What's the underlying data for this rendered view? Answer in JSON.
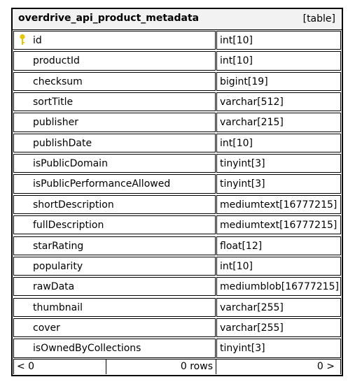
{
  "table": {
    "name": "overdrive_api_product_metadata",
    "kind": "[table]",
    "columns": [
      {
        "name": "id",
        "type": "int[10]",
        "key": true
      },
      {
        "name": "productId",
        "type": "int[10]"
      },
      {
        "name": "checksum",
        "type": "bigint[19]"
      },
      {
        "name": "sortTitle",
        "type": "varchar[512]"
      },
      {
        "name": "publisher",
        "type": "varchar[215]"
      },
      {
        "name": "publishDate",
        "type": "int[10]"
      },
      {
        "name": "isPublicDomain",
        "type": "tinyint[3]"
      },
      {
        "name": "isPublicPerformanceAllowed",
        "type": "tinyint[3]"
      },
      {
        "name": "shortDescription",
        "type": "mediumtext[16777215]"
      },
      {
        "name": "fullDescription",
        "type": "mediumtext[16777215]"
      },
      {
        "name": "starRating",
        "type": "float[12]"
      },
      {
        "name": "popularity",
        "type": "int[10]"
      },
      {
        "name": "rawData",
        "type": "mediumblob[16777215]"
      },
      {
        "name": "thumbnail",
        "type": "varchar[255]"
      },
      {
        "name": "cover",
        "type": "varchar[255]"
      },
      {
        "name": "isOwnedByCollections",
        "type": "tinyint[3]"
      }
    ],
    "footer": {
      "left": "< 0",
      "center": "0 rows",
      "right": "0 >"
    },
    "key_icon": "key-icon",
    "key_color": "#e6c800"
  }
}
